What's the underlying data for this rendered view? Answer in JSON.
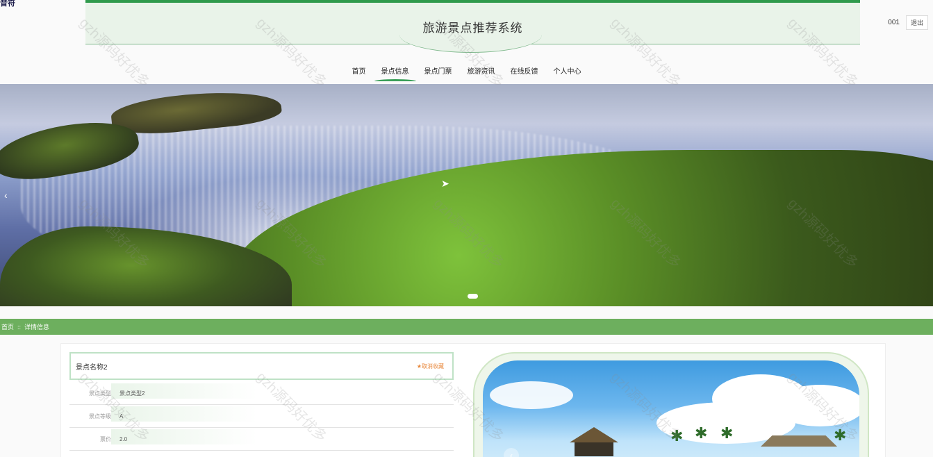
{
  "corner_label": "音符",
  "header": {
    "title": "旅游景点推荐系统"
  },
  "user": {
    "name": "001",
    "logout_label": "退出"
  },
  "nav": {
    "items": [
      {
        "label": "首页",
        "active": false
      },
      {
        "label": "景点信息",
        "active": true
      },
      {
        "label": "景点门票",
        "active": false
      },
      {
        "label": "旅游资讯",
        "active": false
      },
      {
        "label": "在线反馈",
        "active": false
      },
      {
        "label": "个人中心",
        "active": false
      }
    ]
  },
  "banner": {
    "prev_icon": "chevron-left-icon",
    "active_slide": 1
  },
  "breadcrumb": {
    "home": "首页",
    "separator": "::",
    "current": "详情信息"
  },
  "detail": {
    "name": "景点名称2",
    "favorite_label": "★取消收藏",
    "fields": [
      {
        "label": "景点类型",
        "value": "景点类型2"
      },
      {
        "label": "景点等级",
        "value": "A"
      },
      {
        "label": "票价",
        "value": "2.0"
      }
    ]
  },
  "watermark": "gzh源码好优多",
  "colors": {
    "accent": "#2f9a4c",
    "breadcrumb_bg": "#6daf5e",
    "favorite": "#e8873a"
  }
}
